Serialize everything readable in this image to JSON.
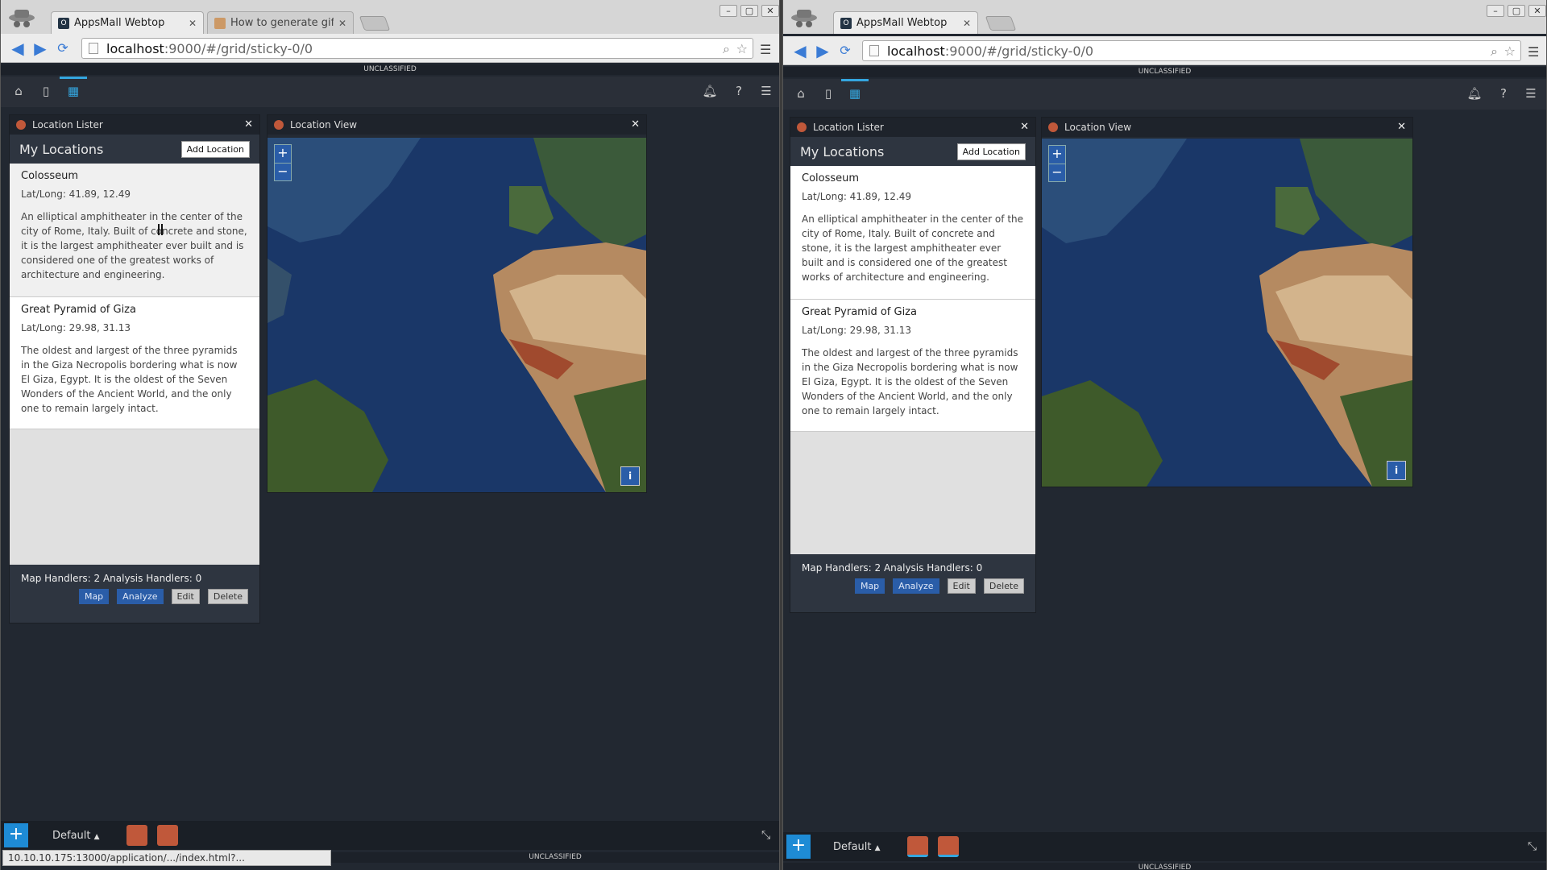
{
  "browser": {
    "window_controls": [
      "–",
      "▢",
      "✕"
    ],
    "tabs_left": [
      {
        "label": "AppsMall Webtop",
        "close": "✕"
      },
      {
        "label": "How to generate gif f",
        "close": "✕"
      }
    ],
    "tabs_right": [
      {
        "label": "AppsMall Webtop",
        "close": "✕"
      }
    ],
    "url": {
      "host": "localhost",
      "path": ":9000/#/grid/sticky-0/0"
    },
    "status_url": "10.10.10.175:13000/application/.../index.html?..."
  },
  "classification": "UNCLASSIFIED",
  "listers": [
    {
      "window_title": "Location Lister",
      "title": "My Locations",
      "add_button": "Add Location",
      "items": [
        {
          "name": "Colosseum",
          "latlong": "Lat/Long: 41.89, 12.49",
          "desc_left": "An elliptical amphitheater in the center of the city of Rome, Italy. Built of concrete and stone, it is the largest amphitheater ever built and is considered one of the greatest works of architecture and engineering."
        },
        {
          "name": "Great Pyramid of Giza",
          "latlong": "Lat/Long: 29.98, 31.13",
          "desc_left": "The oldest and largest of the three pyramids in the Giza Necropolis bordering what is now El Giza, Egypt. It is the oldest of the Seven Wonders of the Ancient World, and the only one to remain largely intact."
        }
      ],
      "handlers": "Map Handlers: 2 Analysis Handlers: 0",
      "actions": [
        "Map",
        "Analyze",
        "Edit",
        "Delete"
      ]
    }
  ],
  "map_view": {
    "title": "Location View",
    "zoom_in": "+",
    "zoom_out": "−",
    "info": "i"
  },
  "dock": {
    "add": "+",
    "layout": "Default",
    "caret": "▲"
  },
  "colors": {
    "accent": "#34a6df",
    "dock_plus": "#1e8bd5",
    "app_icon": "#c0583a",
    "handler_btn": "#2a5da8"
  },
  "icons": [
    "home-icon",
    "bag-icon",
    "grid-layout-icon",
    "bell-icon",
    "help-icon",
    "hamburger-menu-icon",
    "back-arrow-icon",
    "forward-arrow-icon",
    "reload-icon",
    "star-icon",
    "search-icon",
    "expand-icon",
    "map-marker-icon",
    "crosshair-icon"
  ]
}
